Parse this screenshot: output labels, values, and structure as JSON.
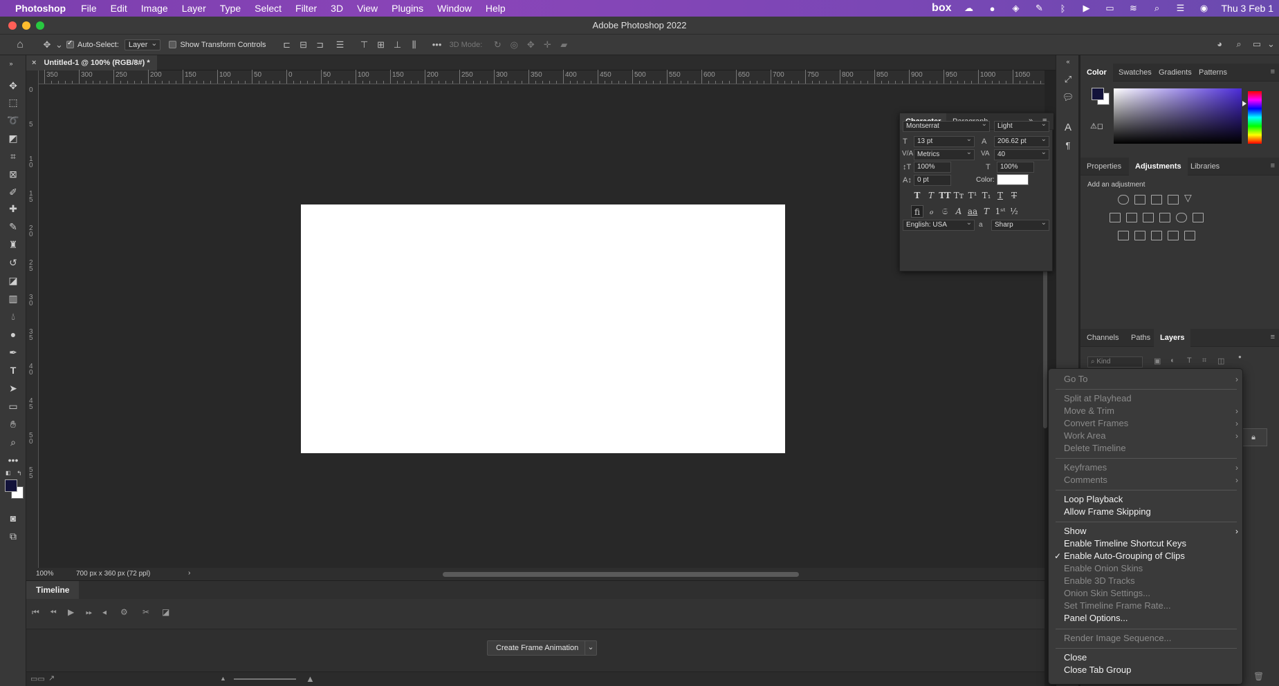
{
  "menubar": {
    "app": "Photoshop",
    "items": [
      "File",
      "Edit",
      "Image",
      "Layer",
      "Type",
      "Select",
      "Filter",
      "3D",
      "View",
      "Plugins",
      "Window",
      "Help"
    ],
    "status_box": "box",
    "datetime": "Thu 3 Feb 1"
  },
  "window": {
    "title": "Adobe Photoshop 2022"
  },
  "options": {
    "auto_select_label": "Auto-Select:",
    "auto_select_value": "Layer",
    "show_transform_label": "Show Transform Controls",
    "mode_3d_label": "3D Mode:"
  },
  "document": {
    "tab_label": "Untitled-1 @ 100% (RGB/8#) *",
    "zoom": "100%",
    "doc_info": "700 px x 360 px (72 ppl)"
  },
  "ruler": {
    "h_labels": [
      "350",
      "300",
      "250",
      "200",
      "150",
      "100",
      "50",
      "0",
      "50",
      "100",
      "150",
      "200",
      "250",
      "300",
      "350",
      "400",
      "450",
      "500",
      "550",
      "600",
      "650",
      "700",
      "750",
      "800",
      "850",
      "900",
      "950",
      "1000",
      "1050"
    ],
    "v_labels": [
      "0",
      "5",
      "1 0",
      "1 5",
      "2 0",
      "2 5",
      "3 0",
      "3 5",
      "4 0",
      "4 5",
      "5 0",
      "5 5"
    ]
  },
  "timeline": {
    "title": "Timeline",
    "create_button": "Create Frame Animation"
  },
  "character": {
    "tabs": [
      "Character",
      "Paragraph"
    ],
    "font_family": "Montserrat",
    "font_style": "Light",
    "font_size": "13 pt",
    "leading": "206.62 pt",
    "kerning": "Metrics",
    "tracking": "40",
    "vertical_scale": "100%",
    "horizontal_scale": "100%",
    "baseline_shift": "0 pt",
    "color_label": "Color:",
    "language": "English: USA",
    "antialias": "Sharp",
    "aa_label": "a",
    "color_swatch": "#ffffff"
  },
  "panels": {
    "color_tabs": [
      "Color",
      "Swatches",
      "Gradients",
      "Patterns"
    ],
    "adjust_tabs": [
      "Properties",
      "Adjustments",
      "Libraries"
    ],
    "add_adjustment": "Add an adjustment",
    "layer_tabs": [
      "Channels",
      "Paths",
      "Layers"
    ],
    "kind_placeholder": "Kind",
    "foreground_color": "#13133a"
  },
  "context_menu": {
    "items": [
      {
        "label": "Go To",
        "submenu": true,
        "disabled": true
      },
      {
        "label": "Split at Playhead",
        "disabled": true
      },
      {
        "label": "Move & Trim",
        "submenu": true,
        "disabled": true
      },
      {
        "label": "Convert Frames",
        "submenu": true,
        "disabled": true
      },
      {
        "label": "Work Area",
        "submenu": true,
        "disabled": true
      },
      {
        "label": "Delete Timeline",
        "disabled": true
      },
      {
        "label": "Keyframes",
        "submenu": true,
        "disabled": true
      },
      {
        "label": "Comments",
        "submenu": true,
        "disabled": true
      },
      {
        "label": "Loop Playback",
        "disabled": false
      },
      {
        "label": "Allow Frame Skipping",
        "disabled": false
      },
      {
        "label": "Show",
        "submenu": true,
        "disabled": false
      },
      {
        "label": "Enable Timeline Shortcut Keys",
        "disabled": false
      },
      {
        "label": "Enable Auto-Grouping of Clips",
        "checked": true,
        "disabled": false
      },
      {
        "label": "Enable Onion Skins",
        "disabled": true
      },
      {
        "label": "Enable 3D Tracks",
        "disabled": true
      },
      {
        "label": "Onion Skin Settings...",
        "disabled": true
      },
      {
        "label": "Set Timeline Frame Rate...",
        "disabled": true
      },
      {
        "label": "Panel Options...",
        "disabled": false
      },
      {
        "label": "Render Image Sequence...",
        "disabled": true
      },
      {
        "label": "Close",
        "disabled": false
      },
      {
        "label": "Close Tab Group",
        "disabled": false
      }
    ]
  }
}
